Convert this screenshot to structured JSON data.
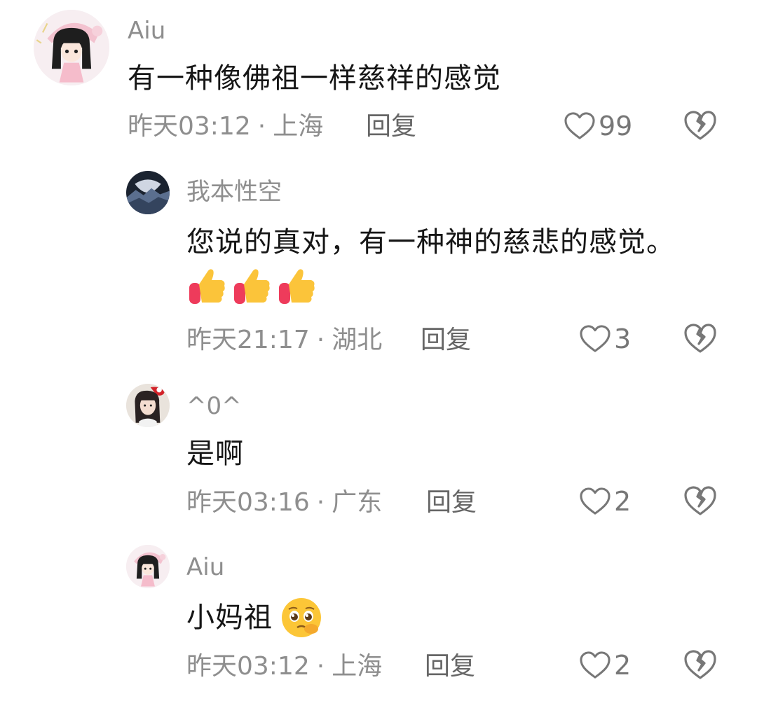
{
  "comments": [
    {
      "user": "Aiu",
      "text": "有一种像佛祖一样慈祥的感觉",
      "time": "昨天03:12",
      "sep": "·",
      "location": "上海",
      "reply_label": "回复",
      "likes": "99",
      "avatar_icon": "anime-girl-avatar"
    },
    {
      "user": "我本性空",
      "text": "您说的真对，有一种神的慈悲的感觉。",
      "emojis": [
        "thumbs-up-emoji",
        "thumbs-up-emoji",
        "thumbs-up-emoji"
      ],
      "time": "昨天21:17",
      "sep": "·",
      "location": "湖北",
      "reply_label": "回复",
      "likes": "3",
      "avatar_icon": "mountain-landscape-avatar"
    },
    {
      "user": "^0^",
      "text": "是啊",
      "time": "昨天03:16",
      "sep": "·",
      "location": "广东",
      "reply_label": "回复",
      "likes": "2",
      "avatar_icon": "girl-photo-avatar"
    },
    {
      "user": "Aiu",
      "text": "小妈祖",
      "emojis": [
        "pleading-face-emoji"
      ],
      "time": "昨天03:12",
      "sep": "·",
      "location": "上海",
      "reply_label": "回复",
      "likes": "2",
      "avatar_icon": "anime-girl-avatar"
    }
  ],
  "colors": {
    "meta_gray": "#8e8e8e",
    "text_black": "#161616",
    "icon_gray": "#777777"
  }
}
